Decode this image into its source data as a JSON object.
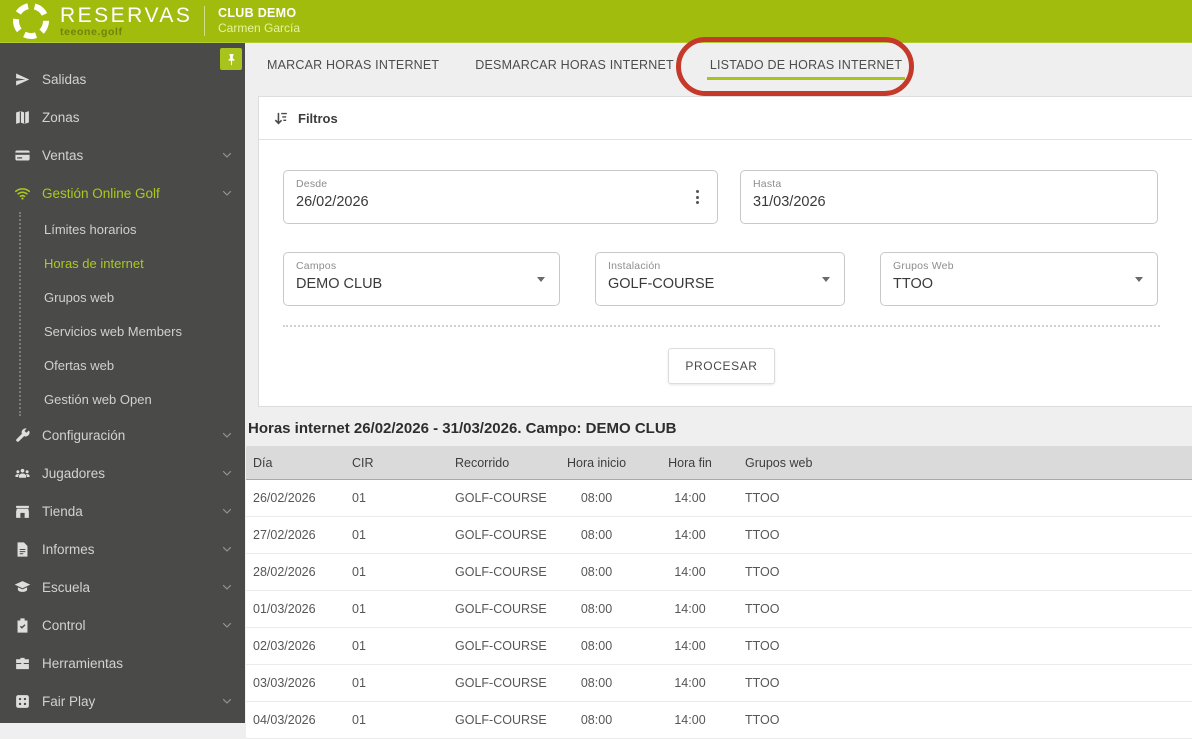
{
  "colors": {
    "header_green": "#a2bc0e",
    "accent_green": "#a8c41c",
    "sidebar_bg": "#4a4a48",
    "annotation_red": "#c5392b"
  },
  "header": {
    "brand": "RESERVAS",
    "brand_sub": "teeone.golf",
    "club": "CLUB DEMO",
    "user": "Carmen García"
  },
  "sidebar": {
    "pin_icon": "pin-icon",
    "items": [
      {
        "label": "Salidas",
        "icon": "send-icon",
        "chevron": false
      },
      {
        "label": "Zonas",
        "icon": "map-icon",
        "chevron": false
      },
      {
        "label": "Ventas",
        "icon": "credit-card-icon",
        "chevron": true
      },
      {
        "label": "Gestión Online Golf",
        "icon": "wifi-icon",
        "chevron": true,
        "active": true,
        "children": [
          {
            "label": "Límites horarios"
          },
          {
            "label": "Horas de internet",
            "active": true
          },
          {
            "label": "Grupos web"
          },
          {
            "label": "Servicios web Members"
          },
          {
            "label": "Ofertas web"
          },
          {
            "label": "Gestión web Open"
          }
        ]
      },
      {
        "label": "Configuración",
        "icon": "wrench-icon",
        "chevron": true
      },
      {
        "label": "Jugadores",
        "icon": "users-icon",
        "chevron": true
      },
      {
        "label": "Tienda",
        "icon": "store-icon",
        "chevron": true
      },
      {
        "label": "Informes",
        "icon": "document-icon",
        "chevron": true
      },
      {
        "label": "Escuela",
        "icon": "school-icon",
        "chevron": true
      },
      {
        "label": "Control",
        "icon": "clipboard-icon",
        "chevron": true
      },
      {
        "label": "Herramientas",
        "icon": "toolbox-icon",
        "chevron": false
      },
      {
        "label": "Fair Play",
        "icon": "dice-icon",
        "chevron": true
      }
    ]
  },
  "tabs": [
    {
      "label": "MARCAR HORAS INTERNET",
      "active": false
    },
    {
      "label": "DESMARCAR HORAS INTERNET",
      "active": false
    },
    {
      "label": "LISTADO DE HORAS INTERNET",
      "active": true,
      "annotated": true
    }
  ],
  "annotation": {
    "shape": "red-rounded-rectangle",
    "target_tab": "LISTADO DE HORAS INTERNET"
  },
  "filters": {
    "title": "Filtros",
    "title_icon": "sort-filter-icon",
    "desde": {
      "label": "Desde",
      "value": "26/02/2026"
    },
    "hasta": {
      "label": "Hasta",
      "value": "31/03/2026"
    },
    "campos": {
      "label": "Campos",
      "value": "DEMO CLUB"
    },
    "instalacion": {
      "label": "Instalación",
      "value": "GOLF-COURSE"
    },
    "grupos_web": {
      "label": "Grupos Web",
      "value": "TTOO"
    },
    "process_label": "PROCESAR"
  },
  "table": {
    "title": "Horas internet 26/02/2026 - 31/03/2026. Campo: DEMO CLUB",
    "columns": [
      "Día",
      "CIR",
      "Recorrido",
      "Hora inicio",
      "Hora fin",
      "Grupos web"
    ],
    "rows": [
      [
        "26/02/2026",
        "01",
        "GOLF-COURSE",
        "08:00",
        "14:00",
        "TTOO"
      ],
      [
        "27/02/2026",
        "01",
        "GOLF-COURSE",
        "08:00",
        "14:00",
        "TTOO"
      ],
      [
        "28/02/2026",
        "01",
        "GOLF-COURSE",
        "08:00",
        "14:00",
        "TTOO"
      ],
      [
        "01/03/2026",
        "01",
        "GOLF-COURSE",
        "08:00",
        "14:00",
        "TTOO"
      ],
      [
        "02/03/2026",
        "01",
        "GOLF-COURSE",
        "08:00",
        "14:00",
        "TTOO"
      ],
      [
        "03/03/2026",
        "01",
        "GOLF-COURSE",
        "08:00",
        "14:00",
        "TTOO"
      ],
      [
        "04/03/2026",
        "01",
        "GOLF-COURSE",
        "08:00",
        "14:00",
        "TTOO"
      ]
    ]
  }
}
